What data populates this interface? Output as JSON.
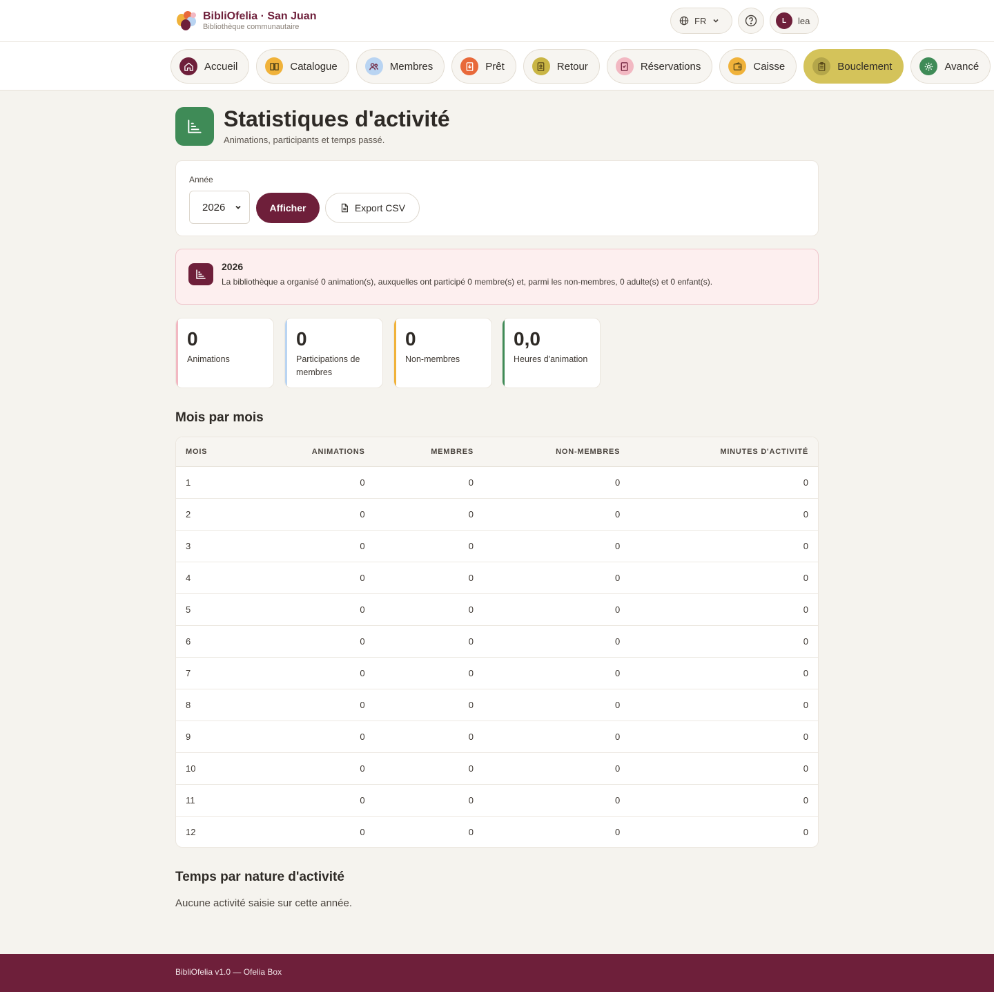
{
  "brand": {
    "name": "BibliOfelia · San Juan",
    "subtitle": "Bibliothèque communautaire"
  },
  "header": {
    "language": "FR",
    "user_initial": "L",
    "user_name": "lea"
  },
  "nav": [
    {
      "label": "Accueil",
      "icon": "home-icon",
      "color": "#6e1f3a"
    },
    {
      "label": "Catalogue",
      "icon": "book-icon",
      "color": "#f0b23a"
    },
    {
      "label": "Membres",
      "icon": "users-icon",
      "color": "#b9d4f2"
    },
    {
      "label": "Prêt",
      "icon": "loan-icon",
      "color": "#e8693a"
    },
    {
      "label": "Retour",
      "icon": "return-icon",
      "color": "#c9b544"
    },
    {
      "label": "Réservations",
      "icon": "bookmark-icon",
      "color": "#f2b8c2"
    },
    {
      "label": "Caisse",
      "icon": "wallet-icon",
      "color": "#f0b23a"
    },
    {
      "label": "Bouclement",
      "icon": "clipboard-icon",
      "color": "#b4a64a",
      "active": true
    },
    {
      "label": "Avancé",
      "icon": "gear-icon",
      "color": "#3f8b57"
    }
  ],
  "page": {
    "title": "Statistiques d'activité",
    "subtitle": "Animations, participants et temps passé."
  },
  "filter": {
    "label": "Année",
    "selected_year": "2026",
    "show_label": "Afficher",
    "export_label": "Export CSV"
  },
  "summary": {
    "year": "2026",
    "text": "La bibliothèque a organisé 0 animation(s), auxquelles ont participé 0 membre(s) et, parmi les non-membres, 0 adulte(s) et 0 enfant(s)."
  },
  "stats": [
    {
      "value": "0",
      "label": "Animations",
      "color": "#f2b8c2"
    },
    {
      "value": "0",
      "label": "Participations de membres",
      "color": "#b9d4f2"
    },
    {
      "value": "0",
      "label": "Non-membres",
      "color": "#f0b23a"
    },
    {
      "value": "0,0",
      "label": "Heures d'animation",
      "color": "#3f8b57"
    }
  ],
  "monthly": {
    "title": "Mois par mois",
    "columns": [
      "MOIS",
      "ANIMATIONS",
      "MEMBRES",
      "NON-MEMBRES",
      "MINUTES D'ACTIVITÉ"
    ],
    "rows": [
      [
        "1",
        "0",
        "0",
        "0",
        "0"
      ],
      [
        "2",
        "0",
        "0",
        "0",
        "0"
      ],
      [
        "3",
        "0",
        "0",
        "0",
        "0"
      ],
      [
        "4",
        "0",
        "0",
        "0",
        "0"
      ],
      [
        "5",
        "0",
        "0",
        "0",
        "0"
      ],
      [
        "6",
        "0",
        "0",
        "0",
        "0"
      ],
      [
        "7",
        "0",
        "0",
        "0",
        "0"
      ],
      [
        "8",
        "0",
        "0",
        "0",
        "0"
      ],
      [
        "9",
        "0",
        "0",
        "0",
        "0"
      ],
      [
        "10",
        "0",
        "0",
        "0",
        "0"
      ],
      [
        "11",
        "0",
        "0",
        "0",
        "0"
      ],
      [
        "12",
        "0",
        "0",
        "0",
        "0"
      ]
    ]
  },
  "activity_time": {
    "title": "Temps par nature d'activité",
    "empty_text": "Aucune activité saisie sur cette année."
  },
  "footer": {
    "text": "BibliOfelia v1.0 — Ofelia Box"
  }
}
